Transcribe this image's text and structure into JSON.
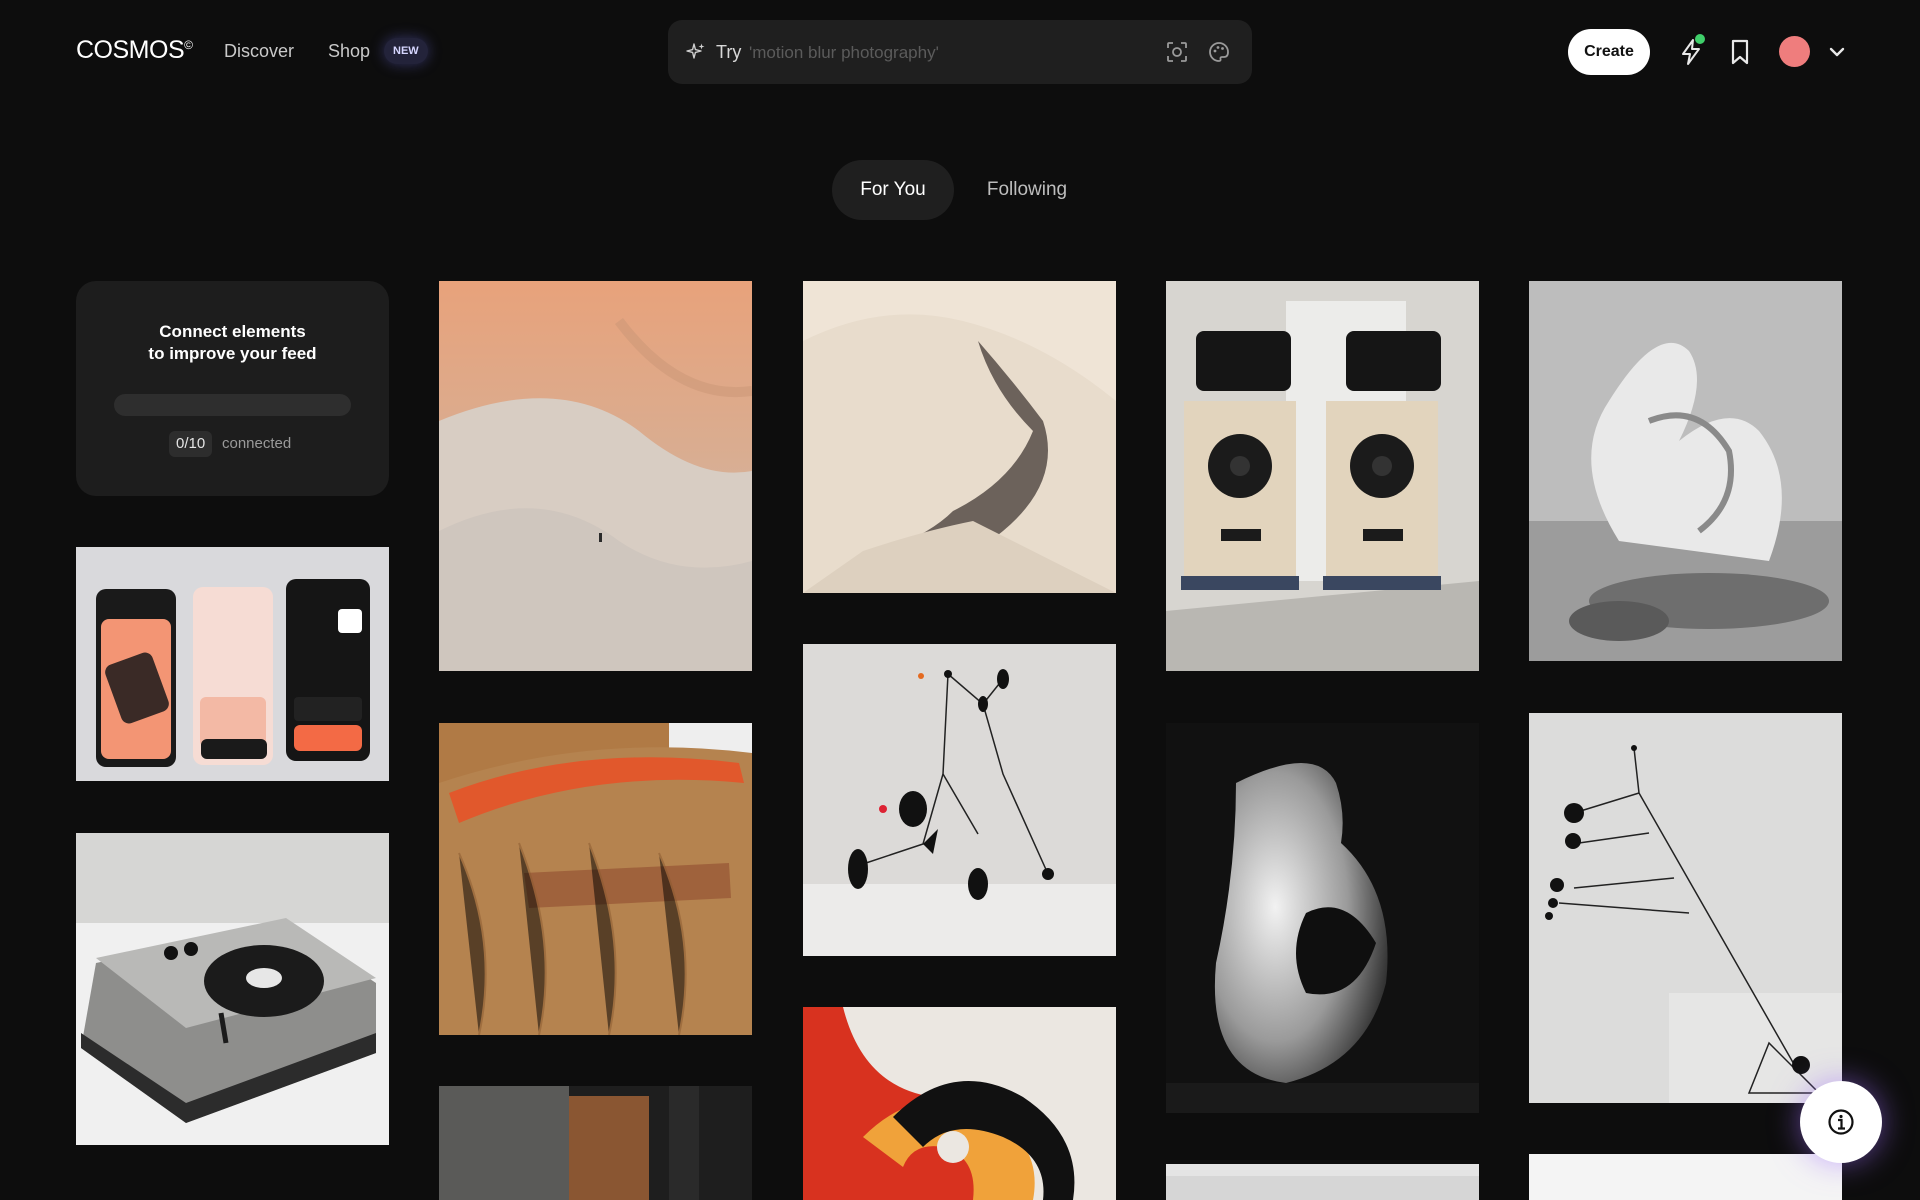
{
  "header": {
    "logo": "COSMOS",
    "logo_mark": "©",
    "nav": [
      {
        "label": "Discover"
      },
      {
        "label": "Shop",
        "badge": "NEW"
      }
    ],
    "search": {
      "prefix": "Try",
      "placeholder": "'motion blur photography'",
      "icons": [
        "sparkle-icon",
        "visual-search-icon",
        "palette-icon"
      ]
    },
    "create_label": "Create",
    "right_icons": [
      "lightning-icon",
      "bookmark-icon",
      "avatar",
      "chevron-down-icon"
    ],
    "notification_dot_color": "#3fcf6a",
    "avatar_color": "#ef7d7d"
  },
  "tabs": [
    {
      "label": "For You",
      "active": true
    },
    {
      "label": "Following",
      "active": false
    }
  ],
  "connect_card": {
    "title_line1": "Connect elements",
    "title_line2": "to improve your feed",
    "connected": "0/10",
    "connected_label": "connected",
    "progress": 0.0
  },
  "feed": [
    {
      "id": "mobile-banking-ui",
      "alt": "Orange mobile finance app screens"
    },
    {
      "id": "record-player",
      "alt": "Gray turntable record player"
    },
    {
      "id": "desert-dunes",
      "alt": "Desert sand dunes with lone figure"
    },
    {
      "id": "orange-comb",
      "alt": "Orange comb in blonde hair"
    },
    {
      "id": "dark-interior",
      "alt": "Dark interior photo (cropped)"
    },
    {
      "id": "sand-shadow",
      "alt": "Sand ridge with shadow"
    },
    {
      "id": "mobile-sculpture",
      "alt": "Black kinetic mobile sculpture"
    },
    {
      "id": "swirl-art",
      "alt": "Red orange black swirl artwork"
    },
    {
      "id": "speakers",
      "alt": "Pair of wooden speaker cabinets"
    },
    {
      "id": "vase-photo",
      "alt": "Black and white ceramic vessel"
    },
    {
      "id": "white-object",
      "alt": "Light photo (cropped)"
    },
    {
      "id": "loop-sculpture",
      "alt": "Concrete ribbon sculpture"
    },
    {
      "id": "wire-mobile",
      "alt": "Black and white wire mobile drawing"
    },
    {
      "id": "white-object-2",
      "alt": "White image (cropped)"
    }
  ],
  "fab_icon": "info-icon"
}
